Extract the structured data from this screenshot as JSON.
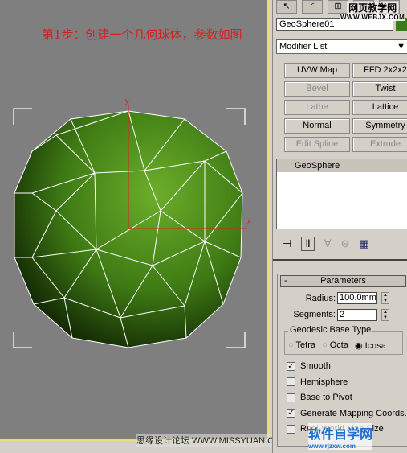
{
  "caption": "第1步：创建一个几何球体，参数如图",
  "footer_watermark": "思缘设计论坛 WWW.MISSYUAN.COM",
  "top_watermark": {
    "title": "网页教学网",
    "url": "WWW.WEBJX.COM"
  },
  "bottom_watermark": {
    "title": "软件自学网",
    "url": "www.rjzxw.com"
  },
  "viewport": {
    "axis_x": "x",
    "axis_y": "y",
    "sphere_color": "#4e8e1e",
    "background": "#7f7f7f",
    "border": "#e6e070"
  },
  "panel": {
    "object_name": "GeoSphere01",
    "object_color": "#3c7c18",
    "modifier_list": "Modifier List",
    "buttons": [
      {
        "label": "UVW Map",
        "enabled": true
      },
      {
        "label": "FFD 2x2x2",
        "enabled": true
      },
      {
        "label": "Bevel",
        "enabled": false
      },
      {
        "label": "Twist",
        "enabled": true
      },
      {
        "label": "Lathe",
        "enabled": false
      },
      {
        "label": "Lattice",
        "enabled": true
      },
      {
        "label": "Normal",
        "enabled": true
      },
      {
        "label": "Symmetry",
        "enabled": true
      },
      {
        "label": "Edit Spline",
        "enabled": false
      },
      {
        "label": "Extrude",
        "enabled": false
      }
    ],
    "stack_item": "GeoSphere",
    "parameters": {
      "title": "Parameters",
      "collapse": "-",
      "radius_label": "Radius:",
      "radius": "100.0mm",
      "segments_label": "Segments:",
      "segments": "2",
      "base_type_label": "Geodesic Base Type",
      "base_types": [
        "Tetra",
        "Octa",
        "Icosa"
      ],
      "base_type_selected": "Icosa",
      "checkboxes": [
        {
          "label": "Smooth",
          "checked": true
        },
        {
          "label": "Hemisphere",
          "checked": false
        },
        {
          "label": "Base to Pivot",
          "checked": false
        },
        {
          "label": "Generate Mapping Coords.",
          "checked": true
        },
        {
          "label": "Real-World Map Size",
          "checked": false
        }
      ]
    }
  }
}
